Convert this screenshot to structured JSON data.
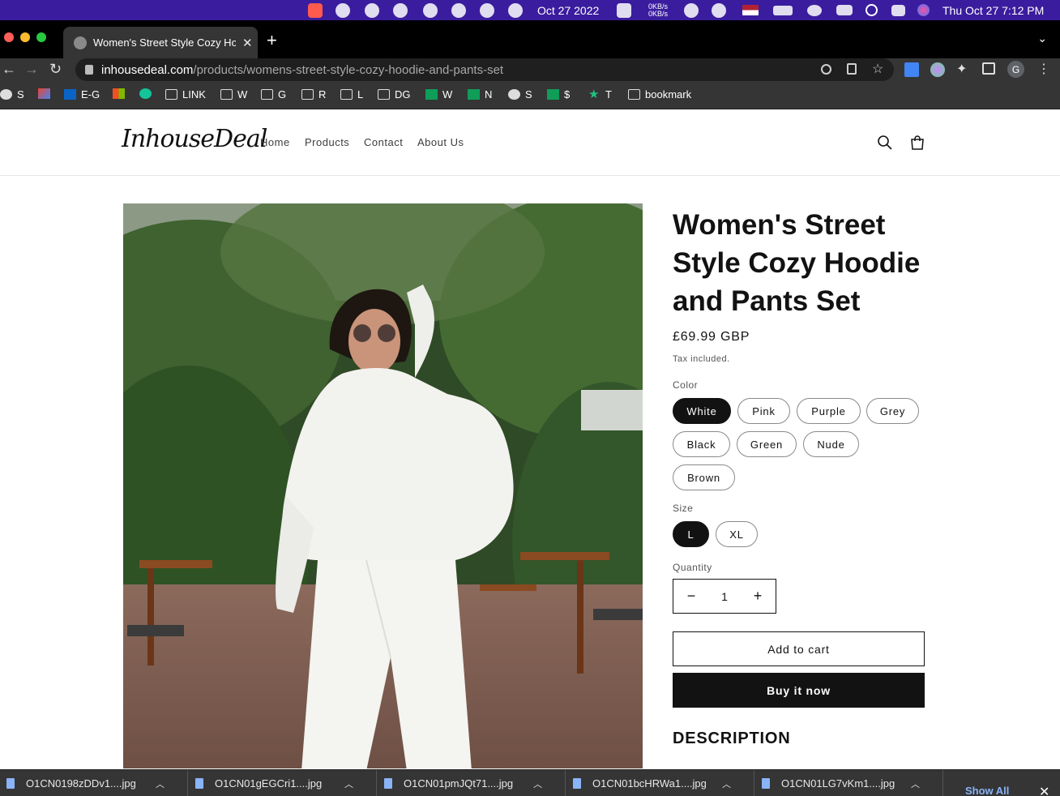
{
  "menubar": {
    "date_center": "Oct 27 2022",
    "net_up": "0KB/s",
    "net_down": "0KB/s",
    "clock": "Thu Oct 27  7:12 PM"
  },
  "browser": {
    "tab_title": "Women's Street Style Cozy Hoodie and Pants Set",
    "url_host": "inhousedeal.com",
    "url_path": "/products/womens-street-style-cozy-hoodie-and-pants-set",
    "profile_initial": "G"
  },
  "bookmarks": [
    {
      "label": "S",
      "icon": "globe-icon"
    },
    {
      "label": "",
      "icon": "gmail-icon"
    },
    {
      "label": "E-G",
      "icon": "outlook-icon"
    },
    {
      "label": "",
      "icon": "microsoft-icon"
    },
    {
      "label": "",
      "icon": "grammarly-icon"
    },
    {
      "label": "LINK",
      "icon": "folder-icon"
    },
    {
      "label": "W",
      "icon": "folder-icon"
    },
    {
      "label": "G",
      "icon": "folder-icon"
    },
    {
      "label": "R",
      "icon": "folder-icon"
    },
    {
      "label": "L",
      "icon": "folder-icon"
    },
    {
      "label": "DG",
      "icon": "folder-icon"
    },
    {
      "label": "W",
      "icon": "sheets-icon"
    },
    {
      "label": "N",
      "icon": "sheets-icon"
    },
    {
      "label": "S",
      "icon": "globe-icon"
    },
    {
      "label": "$",
      "icon": "sheets-icon"
    },
    {
      "label": "T",
      "icon": "star-icon"
    },
    {
      "label": "bookmark",
      "icon": "folder-icon"
    }
  ],
  "site": {
    "logo": "InhouseDeal",
    "nav": [
      "Home",
      "Products",
      "Contact",
      "About Us"
    ]
  },
  "product": {
    "title": "Women's Street Style Cozy Hoodie and Pants Set",
    "price": "£69.99 GBP",
    "tax_note": "Tax included.",
    "color_label": "Color",
    "colors": [
      "White",
      "Pink",
      "Purple",
      "Grey",
      "Black",
      "Green",
      "Nude",
      "Brown"
    ],
    "selected_color": "White",
    "size_label": "Size",
    "sizes": [
      "L",
      "XL"
    ],
    "selected_size": "L",
    "quantity_label": "Quantity",
    "quantity": "1",
    "add_to_cart": "Add to cart",
    "buy_now": "Buy it now",
    "description_heading": "DESCRIPTION"
  },
  "downloads": {
    "files": [
      "O1CN0198zDDv1....jpg",
      "O1CN01gEGCri1....jpg",
      "O1CN01pmJQt71....jpg",
      "O1CN01bcHRWa1....jpg",
      "O1CN01LG7vKm1....jpg"
    ],
    "show_all": "Show All"
  },
  "colors": {
    "menubar_bg": "#3a1d9e",
    "chrome_dark": "#353535",
    "accent_dark": "#121212",
    "link_blue": "#8ab4f8"
  }
}
